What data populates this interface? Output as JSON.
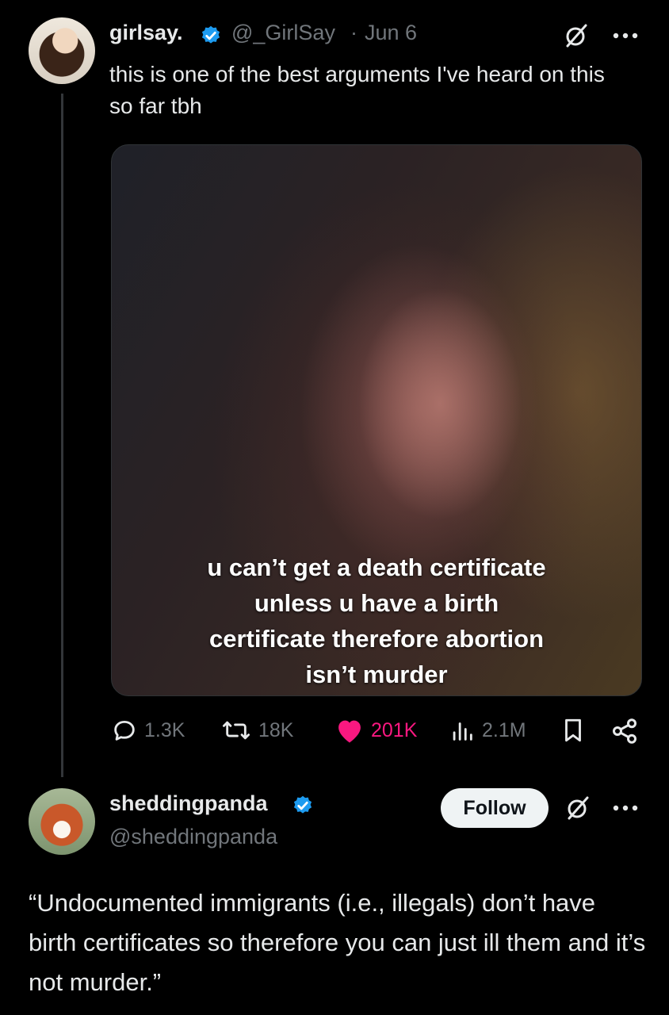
{
  "tweet": {
    "display_name": "girlsay.",
    "handle": "@_GirlSay",
    "separator": "·",
    "date": "Jun 6",
    "text": "this is one of the best arguments I've heard on this so far tbh",
    "media_caption": [
      "u can’t get a death certificate",
      "unless u have a birth",
      "certificate therefore abortion",
      "isn’t murder"
    ],
    "stats": {
      "replies": "1.3K",
      "reposts": "18K",
      "likes": "201K",
      "views": "2.1M"
    },
    "liked": true
  },
  "reply": {
    "display_name": "sheddingpanda",
    "handle": "@sheddingpanda",
    "follow_label": "Follow",
    "text": "“Undocumented immigrants (i.e., illegals) don’t have birth certificates so therefore you can just ill them and it’s not murder.”"
  },
  "colors": {
    "background": "#000000",
    "text": "#e7e9ea",
    "secondary": "#71767b",
    "verified": "#1d9bf0",
    "like": "#f91880"
  },
  "icons": [
    "verified-badge-icon",
    "grok-icon",
    "more-icon",
    "reply-icon",
    "repost-icon",
    "heart-icon",
    "views-icon",
    "bookmark-icon",
    "share-icon"
  ]
}
